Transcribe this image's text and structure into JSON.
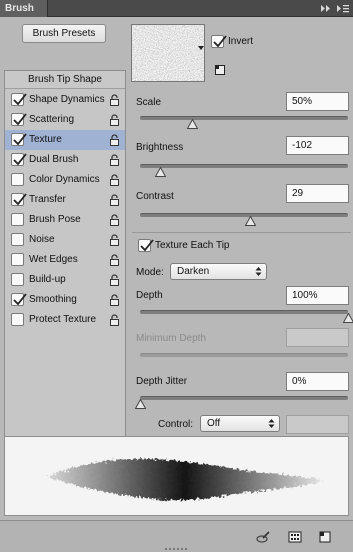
{
  "panel": {
    "tab_label": "Brush",
    "icons": {
      "collapse": "double-chevron-right-icon",
      "menu": "panel-menu-icon"
    }
  },
  "presets_button": "Brush Presets",
  "list": {
    "header": "Brush Tip Shape",
    "items": [
      {
        "label": "Shape Dynamics",
        "checked": true,
        "selected": false,
        "locked": true
      },
      {
        "label": "Scattering",
        "checked": true,
        "selected": false,
        "locked": true
      },
      {
        "label": "Texture",
        "checked": true,
        "selected": true,
        "locked": true
      },
      {
        "label": "Dual Brush",
        "checked": true,
        "selected": false,
        "locked": true
      },
      {
        "label": "Color Dynamics",
        "checked": false,
        "selected": false,
        "locked": true
      },
      {
        "label": "Transfer",
        "checked": true,
        "selected": false,
        "locked": true
      },
      {
        "label": "Brush Pose",
        "checked": false,
        "selected": false,
        "locked": true
      },
      {
        "label": "Noise",
        "checked": false,
        "selected": false,
        "locked": true
      },
      {
        "label": "Wet Edges",
        "checked": false,
        "selected": false,
        "locked": true
      },
      {
        "label": "Build-up",
        "checked": false,
        "selected": false,
        "locked": true
      },
      {
        "label": "Smoothing",
        "checked": true,
        "selected": false,
        "locked": true
      },
      {
        "label": "Protect Texture",
        "checked": false,
        "selected": false,
        "locked": true
      }
    ]
  },
  "texture": {
    "invert": {
      "label": "Invert",
      "checked": true
    },
    "scale": {
      "label": "Scale",
      "value": "50%",
      "level": 0.25
    },
    "brightness": {
      "label": "Brightness",
      "value": "-102",
      "level": 0.1
    },
    "contrast": {
      "label": "Contrast",
      "value": "29",
      "level": 0.53
    },
    "texture_each_tip": {
      "label": "Texture Each Tip",
      "checked": true
    },
    "mode": {
      "label": "Mode:",
      "value": "Darken"
    },
    "depth": {
      "label": "Depth",
      "value": "100%",
      "level": 1.0
    },
    "minimum_depth": {
      "label": "Minimum Depth",
      "value": "",
      "enabled": false
    },
    "depth_jitter": {
      "label": "Depth Jitter",
      "value": "0%",
      "level": 0.0
    },
    "control": {
      "label": "Control:",
      "value": "Off"
    }
  },
  "bottom_icons": [
    "brush-toggle-icon",
    "grid-icon",
    "new-preset-icon"
  ],
  "colors": {
    "selected_row": "#9fb2d4",
    "panel_bg": "#b8b8b8"
  }
}
